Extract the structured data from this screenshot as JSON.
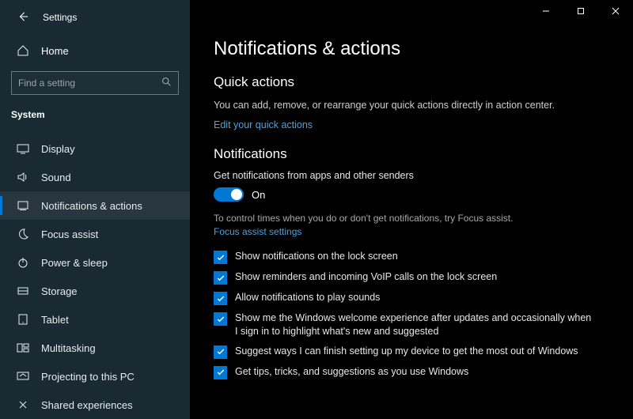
{
  "window": {
    "title": "Settings"
  },
  "sidebar": {
    "home_label": "Home",
    "search_placeholder": "Find a setting",
    "category": "System",
    "items": [
      {
        "icon": "display-icon",
        "label": "Display"
      },
      {
        "icon": "sound-icon",
        "label": "Sound"
      },
      {
        "icon": "bell-icon",
        "label": "Notifications & actions"
      },
      {
        "icon": "moon-icon",
        "label": "Focus assist"
      },
      {
        "icon": "power-icon",
        "label": "Power & sleep"
      },
      {
        "icon": "storage-icon",
        "label": "Storage"
      },
      {
        "icon": "tablet-icon",
        "label": "Tablet"
      },
      {
        "icon": "multitask-icon",
        "label": "Multitasking"
      },
      {
        "icon": "projecting-icon",
        "label": "Projecting to this PC"
      },
      {
        "icon": "share-icon",
        "label": "Shared experiences"
      }
    ]
  },
  "page": {
    "title": "Notifications & actions",
    "quick_actions": {
      "heading": "Quick actions",
      "desc": "You can add, remove, or rearrange your quick actions directly in action center.",
      "link": "Edit your quick actions"
    },
    "notifications": {
      "heading": "Notifications",
      "subhead": "Get notifications from apps and other senders",
      "toggle_state": "On",
      "hint": "To control times when you do or don't get notifications, try Focus assist.",
      "hint_link": "Focus assist settings",
      "checkboxes": [
        "Show notifications on the lock screen",
        "Show reminders and incoming VoIP calls on the lock screen",
        "Allow notifications to play sounds",
        "Show me the Windows welcome experience after updates and occasionally when I sign in to highlight what's new and suggested",
        "Suggest ways I can finish setting up my device to get the most out of Windows",
        "Get tips, tricks, and suggestions as you use Windows"
      ]
    }
  }
}
